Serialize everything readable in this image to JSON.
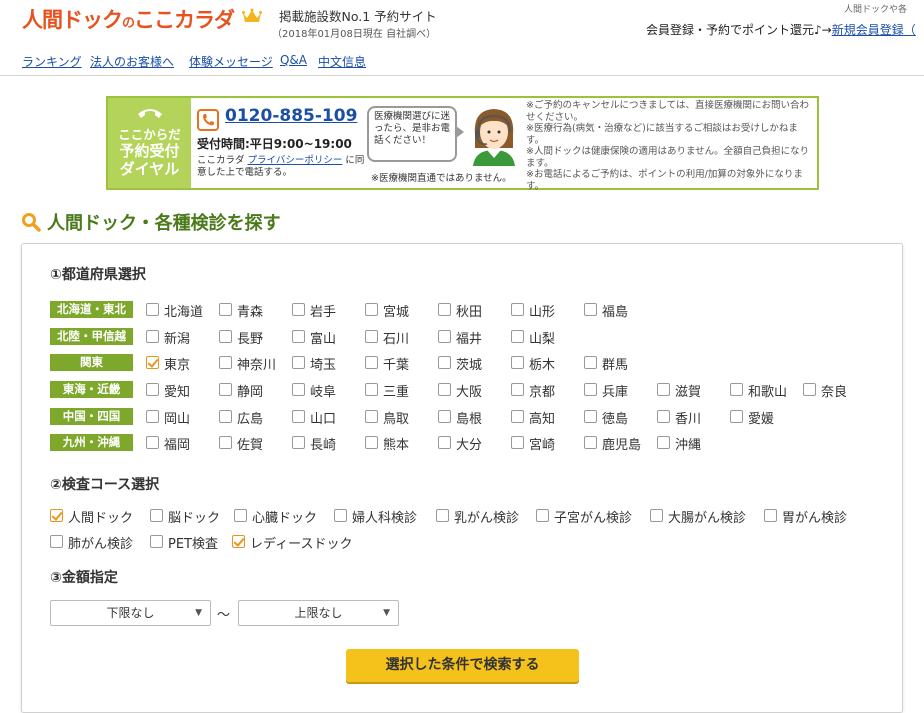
{
  "header": {
    "logo_main": "人間ドック",
    "logo_no": "の",
    "logo_brand": "ここカラダ",
    "tagline": "掲載施設数No.1 予約サイト",
    "tagline_note": "（2018年01月08日現在 自社調べ）",
    "top_right": "人間ドックや各",
    "member_text": "会員登録・予約でポイント還元♪→",
    "member_link": "新規会員登録（"
  },
  "nav": [
    "ランキング",
    "法人のお客様へ",
    "体験メッセージ",
    "Q&A",
    "中文信息"
  ],
  "banner": {
    "left_l1": "ここからだ",
    "left_l2": "予約受付",
    "left_l3": "ダイヤル",
    "tel": "0120-885-109",
    "hours": "受付時間:平日9:00~19:00",
    "privacy_pre": "ここカラダ ",
    "privacy_link": "プライバシーポリシー",
    "privacy_post": " に同意した上で電話する。",
    "bubble": "医療機関選びに迷ったら、是非お電話ください！",
    "direct": "※医療機関直通ではありません。",
    "notes": [
      "※ご予約のキャンセルにつきましては、直接医療機関にお問い合わせください。",
      "※医療行為(病気・治療など)に該当するご相談はお受けしかねます。",
      "※人間ドックは健康保険の適用はありません。全額自己負担になります。",
      "※お電話によるご予約は、ポイントの利用/加算の対象外になります。"
    ]
  },
  "search_title": "人間ドック・各種検診を探す",
  "prefecture": {
    "heading": "①都道府県選択",
    "regions": [
      {
        "label": "北海道・東北",
        "items": [
          {
            "name": "北海道",
            "checked": false
          },
          {
            "name": "青森",
            "checked": false
          },
          {
            "name": "岩手",
            "checked": false
          },
          {
            "name": "宮城",
            "checked": false
          },
          {
            "name": "秋田",
            "checked": false
          },
          {
            "name": "山形",
            "checked": false
          },
          {
            "name": "福島",
            "checked": false
          }
        ]
      },
      {
        "label": "北陸・甲信越",
        "items": [
          {
            "name": "新潟",
            "checked": false
          },
          {
            "name": "長野",
            "checked": false
          },
          {
            "name": "富山",
            "checked": false
          },
          {
            "name": "石川",
            "checked": false
          },
          {
            "name": "福井",
            "checked": false
          },
          {
            "name": "山梨",
            "checked": false
          }
        ]
      },
      {
        "label": "関東",
        "items": [
          {
            "name": "東京",
            "checked": true
          },
          {
            "name": "神奈川",
            "checked": false
          },
          {
            "name": "埼玉",
            "checked": false
          },
          {
            "name": "千葉",
            "checked": false
          },
          {
            "name": "茨城",
            "checked": false
          },
          {
            "name": "栃木",
            "checked": false
          },
          {
            "name": "群馬",
            "checked": false
          }
        ]
      },
      {
        "label": "東海・近畿",
        "items": [
          {
            "name": "愛知",
            "checked": false
          },
          {
            "name": "静岡",
            "checked": false
          },
          {
            "name": "岐阜",
            "checked": false
          },
          {
            "name": "三重",
            "checked": false
          },
          {
            "name": "大阪",
            "checked": false
          },
          {
            "name": "京都",
            "checked": false
          },
          {
            "name": "兵庫",
            "checked": false
          },
          {
            "name": "滋賀",
            "checked": false
          },
          {
            "name": "和歌山",
            "checked": false
          },
          {
            "name": "奈良",
            "checked": false
          }
        ]
      },
      {
        "label": "中国・四国",
        "items": [
          {
            "name": "岡山",
            "checked": false
          },
          {
            "name": "広島",
            "checked": false
          },
          {
            "name": "山口",
            "checked": false
          },
          {
            "name": "鳥取",
            "checked": false
          },
          {
            "name": "島根",
            "checked": false
          },
          {
            "name": "高知",
            "checked": false
          },
          {
            "name": "徳島",
            "checked": false
          },
          {
            "name": "香川",
            "checked": false
          },
          {
            "name": "愛媛",
            "checked": false
          }
        ]
      },
      {
        "label": "九州・沖縄",
        "items": [
          {
            "name": "福岡",
            "checked": false
          },
          {
            "name": "佐賀",
            "checked": false
          },
          {
            "name": "長崎",
            "checked": false
          },
          {
            "name": "熊本",
            "checked": false
          },
          {
            "name": "大分",
            "checked": false
          },
          {
            "name": "宮崎",
            "checked": false
          },
          {
            "name": "鹿児島",
            "checked": false
          },
          {
            "name": "沖縄",
            "checked": false
          }
        ]
      }
    ]
  },
  "course": {
    "heading": "②検査コース選択",
    "rows": [
      [
        {
          "name": "人間ドック",
          "checked": true
        },
        {
          "name": "脳ドック",
          "checked": false
        },
        {
          "name": "心臓ドック",
          "checked": false
        },
        {
          "name": "婦人科検診",
          "checked": false
        },
        {
          "name": "乳がん検診",
          "checked": false
        },
        {
          "name": "子宮がん検診",
          "checked": false
        },
        {
          "name": "大腸がん検診",
          "checked": false
        },
        {
          "name": "胃がん検診",
          "checked": false
        }
      ],
      [
        {
          "name": "肺がん検診",
          "checked": false
        },
        {
          "name": "PET検査",
          "checked": false
        },
        {
          "name": "レディースドック",
          "checked": true
        }
      ]
    ]
  },
  "price": {
    "heading": "③金額指定",
    "min": "下限なし",
    "max": "上限なし",
    "tilde": "～"
  },
  "search_button": "選択した条件で検索する"
}
